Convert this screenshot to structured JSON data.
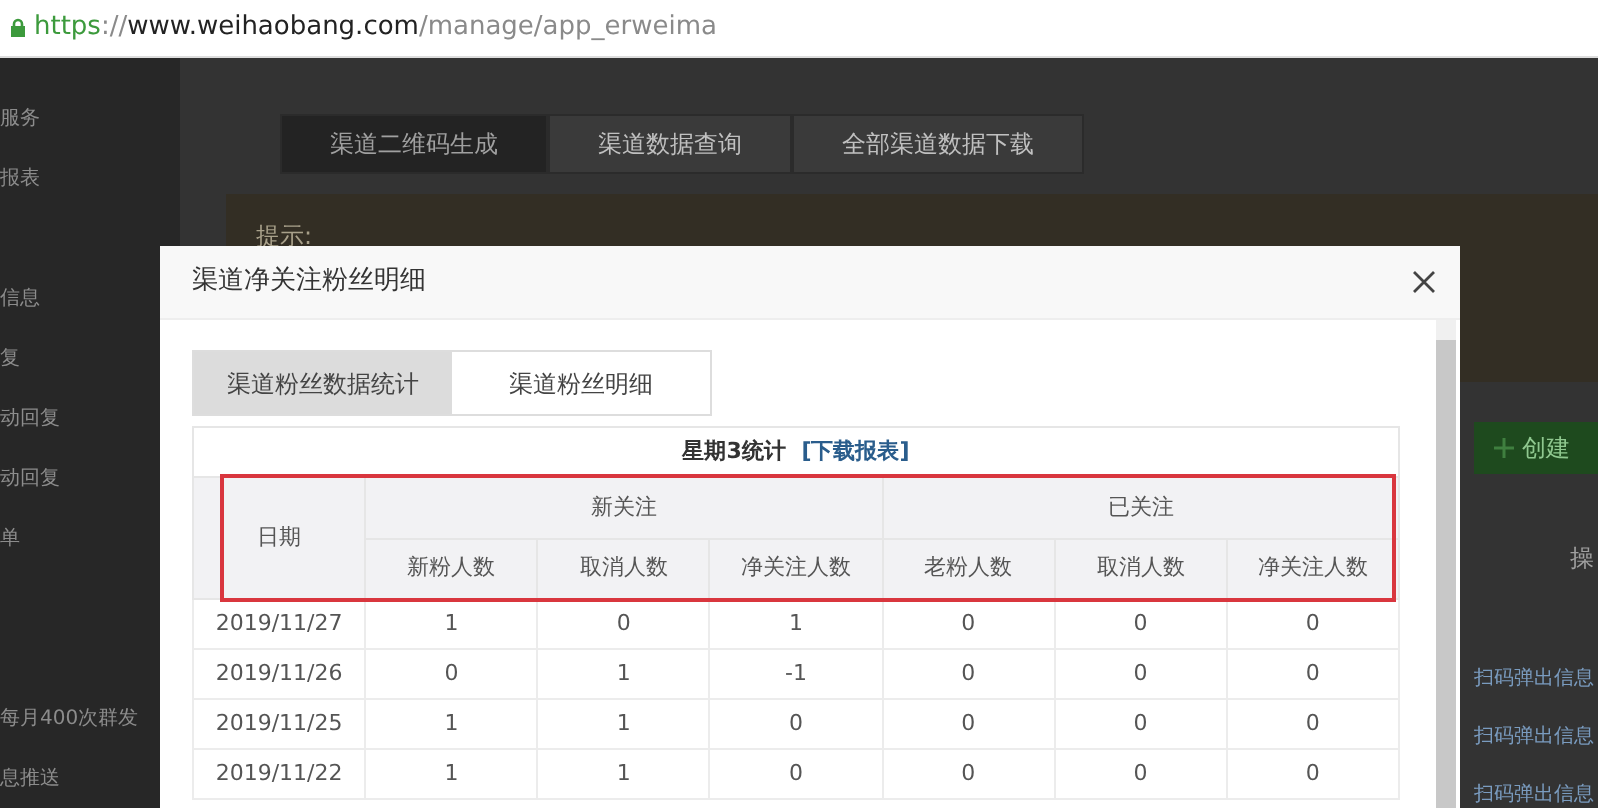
{
  "address_bar": {
    "url_parts": [
      {
        "text": "https",
        "kind": "scheme"
      },
      {
        "text": "://",
        "kind": "muted"
      },
      {
        "text": "www.weihaobang.com",
        "kind": "host"
      },
      {
        "text": "/manage/app_erweima",
        "kind": "muted"
      }
    ]
  },
  "sidebar": {
    "groups": [
      [
        "服务",
        "报表"
      ],
      [
        "信息",
        "复",
        "动回复",
        "动回复",
        "单"
      ],
      [
        "每月400次群发",
        "息推送"
      ]
    ]
  },
  "page_tabs": [
    {
      "label": "渠道二维码生成",
      "selected": true
    },
    {
      "label": "渠道数据查询",
      "selected": false
    },
    {
      "label": "全部渠道数据下载",
      "selected": false
    }
  ],
  "tip": {
    "label": "提示:"
  },
  "create_button": {
    "label": "创建"
  },
  "background_table": {
    "header": "操",
    "rows": [
      "扫码弹出信息",
      "扫码弹出信息",
      "扫码弹出信息"
    ]
  },
  "modal": {
    "title": "渠道净关注粉丝明细",
    "tabs": [
      {
        "label": "渠道粉丝数据统计",
        "selected": true
      },
      {
        "label": "渠道粉丝明细",
        "selected": false
      }
    ],
    "table": {
      "caption": "星期3统计",
      "link": "[下载报表]",
      "date_header": "日期",
      "groups": [
        "新关注",
        "已关注"
      ],
      "columns": [
        "新粉人数",
        "取消人数",
        "净关注人数",
        "老粉人数",
        "取消人数",
        "净关注人数"
      ],
      "rows": [
        {
          "date": "2019/11/27",
          "values": [
            "1",
            "0",
            "1",
            "0",
            "0",
            "0"
          ]
        },
        {
          "date": "2019/11/26",
          "values": [
            "0",
            "1",
            "-1",
            "0",
            "0",
            "0"
          ]
        },
        {
          "date": "2019/11/25",
          "values": [
            "1",
            "1",
            "0",
            "0",
            "0",
            "0"
          ]
        },
        {
          "date": "2019/11/22",
          "values": [
            "1",
            "1",
            "0",
            "0",
            "0",
            "0"
          ]
        }
      ]
    }
  }
}
